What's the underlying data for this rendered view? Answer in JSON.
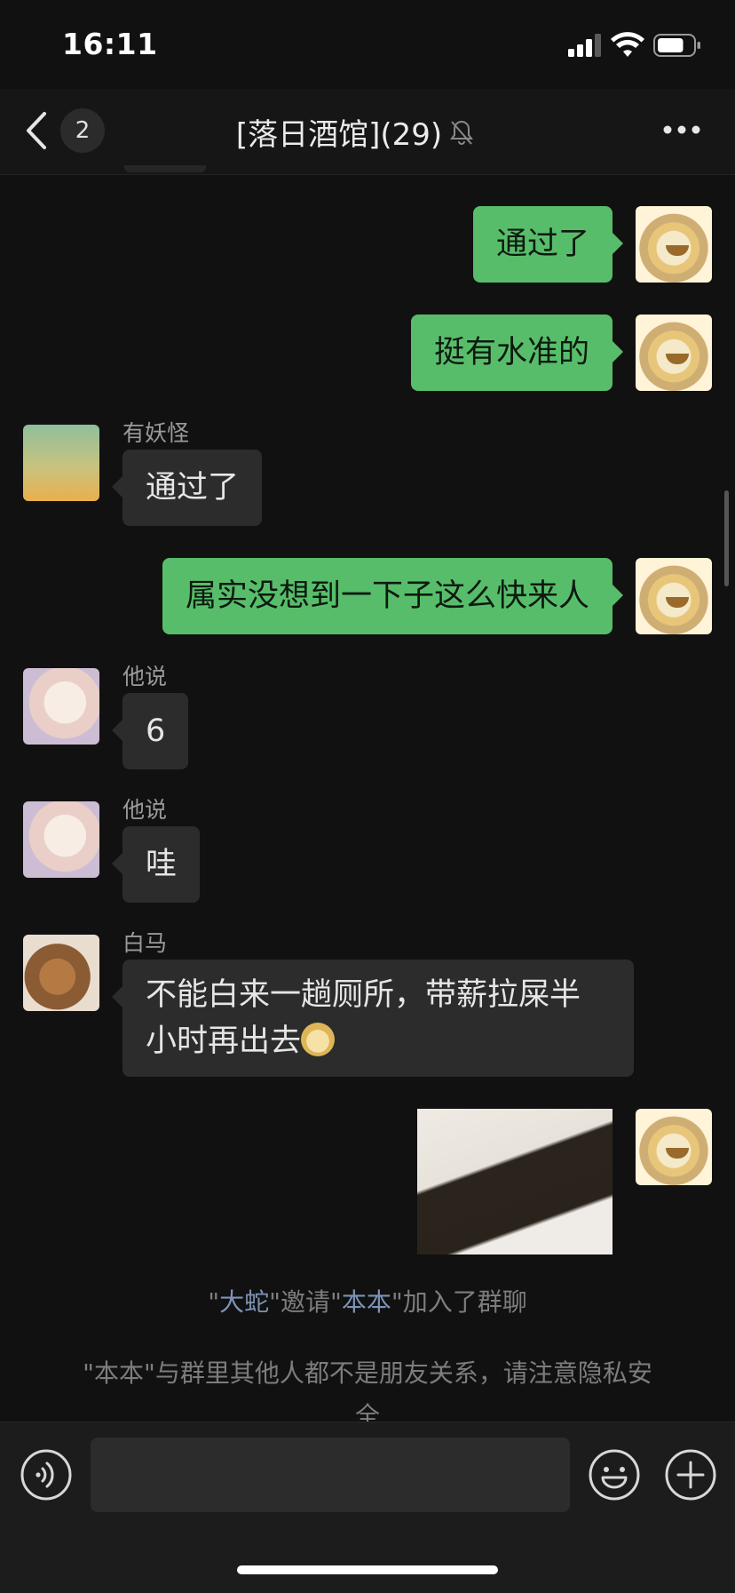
{
  "status_bar": {
    "time": "16:11",
    "battery_level": 0.75
  },
  "header": {
    "back_badge": "2",
    "title": "[落日酒馆](29)"
  },
  "messages": [
    {
      "side": "out",
      "text": "通过了"
    },
    {
      "side": "out",
      "text": "挺有水准的"
    },
    {
      "side": "in",
      "sender": "有妖怪",
      "text": "通过了"
    },
    {
      "side": "out",
      "text": "属实没想到一下子这么快来人"
    },
    {
      "side": "in",
      "sender": "他说",
      "text": "6"
    },
    {
      "side": "in",
      "sender": "他说",
      "text": "哇"
    },
    {
      "side": "in",
      "sender": "白马",
      "line1": "不能白来一趟厕所，带薪拉屎半",
      "line2": "小时再出去"
    },
    {
      "side": "out",
      "type": "image"
    }
  ],
  "system": {
    "invite": {
      "q1": "\"",
      "inviter": "大蛇",
      "q2": "\"邀请\"",
      "invitee": "本本",
      "q3": "\"加入了群聊"
    },
    "privacy": {
      "line1": "\"本本\"与群里其他人都不是朋友关系，请注意隐私安",
      "line2": "全"
    }
  },
  "input_bar": {
    "placeholder": ""
  },
  "icons": [
    "back-icon",
    "bell-muted-icon",
    "more-icon",
    "voice-icon",
    "emoji-icon",
    "plus-icon",
    "signal-icon",
    "wifi-icon",
    "battery-icon"
  ]
}
